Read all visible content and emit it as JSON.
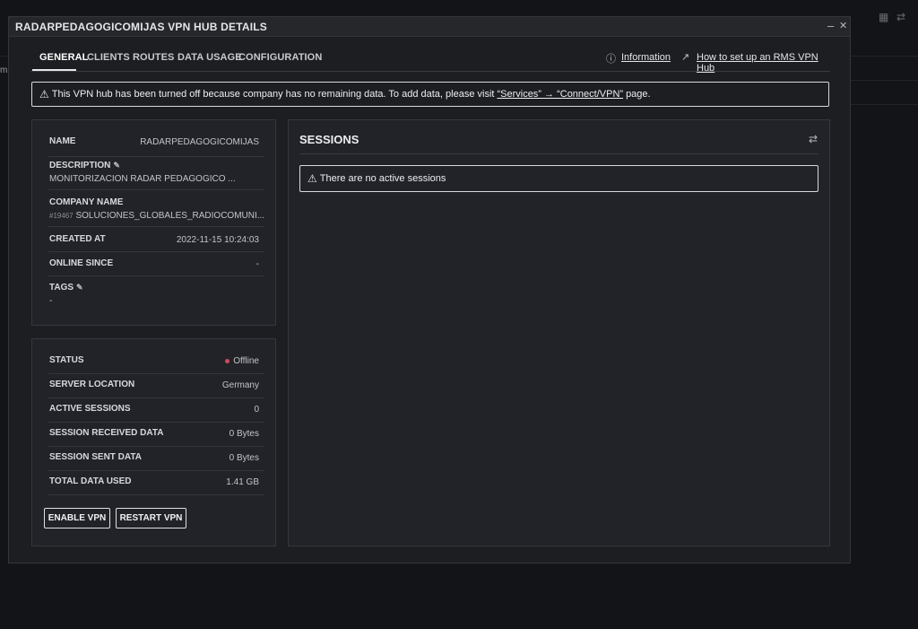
{
  "background": {
    "left_fragment": "mil"
  },
  "modal": {
    "title": "RADARPEDAGOGICOMIJAS VPN HUB DETAILS",
    "minimize": "–",
    "close": "✕"
  },
  "tabs": [
    {
      "label": "GENERAL",
      "active": true
    },
    {
      "label": "CLIENTS"
    },
    {
      "label": "ROUTES"
    },
    {
      "label": "DATA USAGE"
    },
    {
      "label": "CONFIGURATION"
    }
  ],
  "help_links": {
    "information": "Information",
    "setup": "How to set up an RMS VPN Hub"
  },
  "alert": {
    "text_before": "This VPN hub has been turned off because company has no remaining data. To add data, please visit",
    "link": "“Services” → “Connect/VPN”",
    "text_after": "page."
  },
  "details": {
    "name_label": "NAME",
    "name_value": "RADARPEDAGOGICOMIJAS",
    "description_label": "DESCRIPTION",
    "description_value": "MONITORIZACION RADAR PEDAGOGICO ...",
    "company_label": "COMPANY NAME",
    "company_id": "#19467",
    "company_value": "SOLUCIONES_GLOBALES_RADIOCOMUNI...",
    "created_label": "CREATED AT",
    "created_value": "2022-11-15 10:24:03",
    "online_label": "ONLINE SINCE",
    "online_value": "-",
    "tags_label": "TAGS",
    "tags_value": "-"
  },
  "status": {
    "status_label": "STATUS",
    "status_value": "Offline",
    "status_color": "#d04a5a",
    "location_label": "SERVER LOCATION",
    "location_value": "Germany",
    "active_label": "ACTIVE SESSIONS",
    "active_value": "0",
    "received_label": "SESSION RECEIVED DATA",
    "received_value": "0 Bytes",
    "sent_label": "SESSION SENT DATA",
    "sent_value": "0 Bytes",
    "total_label": "TOTAL DATA USED",
    "total_value": "1.41 GB",
    "enable_button": "ENABLE VPN",
    "restart_button": "RESTART VPN"
  },
  "sessions": {
    "title": "SESSIONS",
    "empty_message": "There are no active sessions"
  },
  "icons": {
    "grid": "grid-icon",
    "refresh": "refresh-icon",
    "warning": "warning-icon",
    "help": "help-circle-icon",
    "external": "external-link-icon",
    "edit": "edit-icon"
  }
}
